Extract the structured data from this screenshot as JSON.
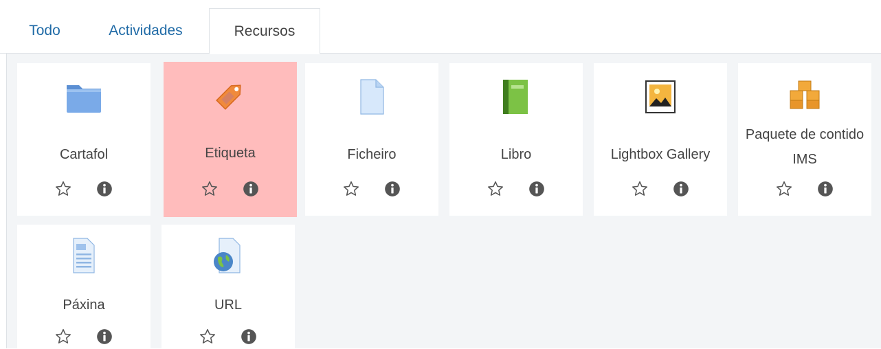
{
  "tabs": [
    {
      "label": "Todo",
      "active": false
    },
    {
      "label": "Actividades",
      "active": false
    },
    {
      "label": "Recursos",
      "active": true
    }
  ],
  "items": [
    {
      "label": "Cartafol",
      "icon": "folder-icon"
    },
    {
      "label": "Etiqueta",
      "icon": "tag-icon",
      "selected": true
    },
    {
      "label": "Ficheiro",
      "icon": "file-icon"
    },
    {
      "label": "Libro",
      "icon": "book-icon"
    },
    {
      "label": "Lightbox Gallery",
      "icon": "image-icon"
    },
    {
      "label": "Paquete de contido IMS",
      "icon": "package-icon"
    },
    {
      "label": "Páxina",
      "icon": "page-icon"
    },
    {
      "label": "URL",
      "icon": "url-icon"
    }
  ],
  "colors": {
    "tab_link": "#1f6aa6",
    "selected_bg": "#ffbcbc",
    "panel_bg": "#f3f5f7"
  }
}
